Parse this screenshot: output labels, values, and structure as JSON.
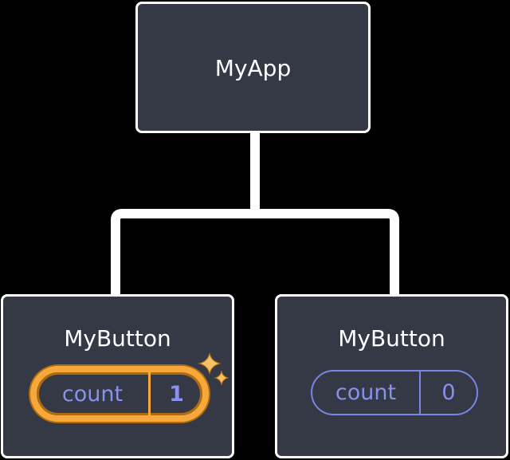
{
  "root": {
    "title": "MyApp"
  },
  "children": [
    {
      "title": "MyButton",
      "label": "count",
      "value": "1",
      "highlighted": true
    },
    {
      "title": "MyButton",
      "label": "count",
      "value": "0",
      "highlighted": false
    }
  ],
  "colors": {
    "node_bg": "#353945",
    "border": "#ffffff",
    "highlight": "#F6A83A",
    "accent": "#8891EC"
  },
  "icons": {
    "sparkle": "sparkle-icon"
  }
}
